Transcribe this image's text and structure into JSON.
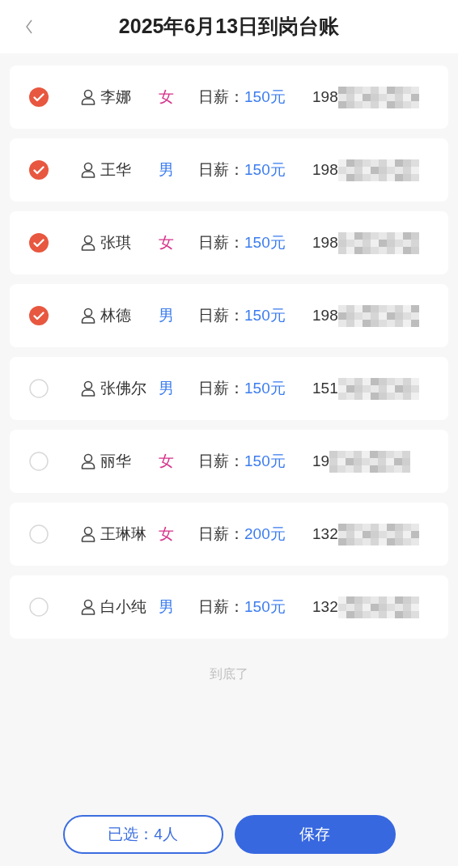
{
  "header": {
    "title": "2025年6月13日到岗台账"
  },
  "workers": [
    {
      "selected": true,
      "name": "李娜",
      "gender": {
        "text": "女",
        "color": "#d6338a"
      },
      "wage_label": "日薪：",
      "wage": "150元",
      "phone": "198"
    },
    {
      "selected": true,
      "name": "王华",
      "gender": {
        "text": "男",
        "color": "#3b7cf0"
      },
      "wage_label": "日薪：",
      "wage": "150元",
      "phone": "198"
    },
    {
      "selected": true,
      "name": "张琪",
      "gender": {
        "text": "女",
        "color": "#d6338a"
      },
      "wage_label": "日薪：",
      "wage": "150元",
      "phone": "198"
    },
    {
      "selected": true,
      "name": "林德",
      "gender": {
        "text": "男",
        "color": "#3b7cf0"
      },
      "wage_label": "日薪：",
      "wage": "150元",
      "phone": "198"
    },
    {
      "selected": false,
      "name": "张佛尔",
      "gender": {
        "text": "男",
        "color": "#3b7cf0"
      },
      "wage_label": "日薪：",
      "wage": "150元",
      "phone": "151"
    },
    {
      "selected": false,
      "name": "丽华",
      "gender": {
        "text": "女",
        "color": "#d6338a"
      },
      "wage_label": "日薪：",
      "wage": "150元",
      "phone": "19"
    },
    {
      "selected": false,
      "name": "王琳琳",
      "gender": {
        "text": "女",
        "color": "#d6338a"
      },
      "wage_label": "日薪：",
      "wage": "200元",
      "phone": "132"
    },
    {
      "selected": false,
      "name": "白小纯",
      "gender": {
        "text": "男",
        "color": "#3b7cf0"
      },
      "wage_label": "日薪：",
      "wage": "150元",
      "phone": "132"
    }
  ],
  "end_note": "到底了",
  "footer": {
    "selected_count": "已选：4人",
    "save": "保存"
  }
}
